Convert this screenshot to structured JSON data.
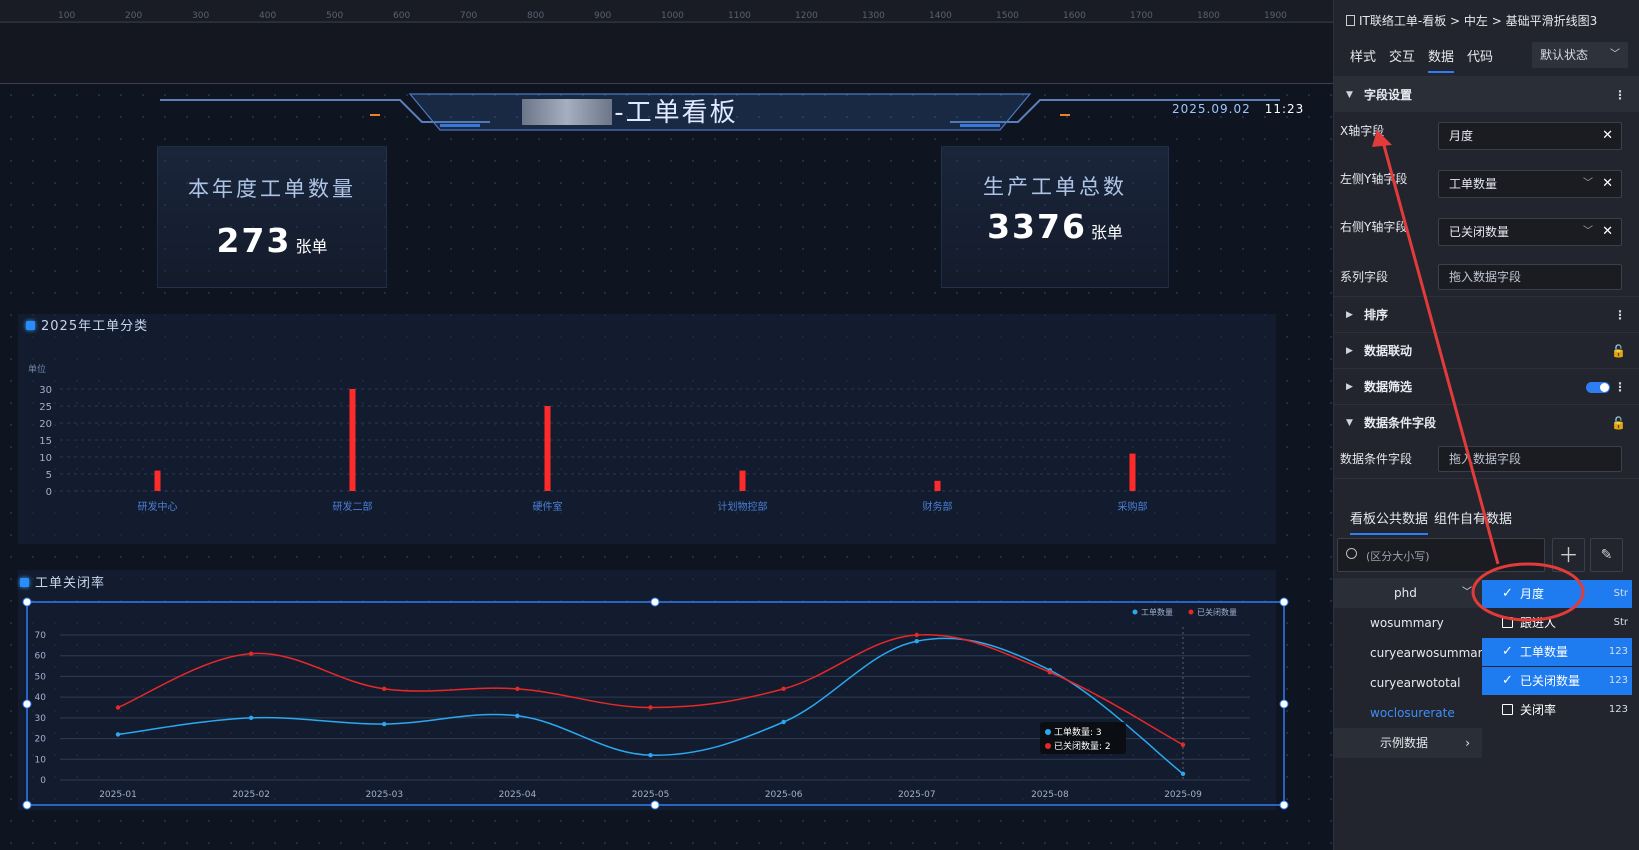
{
  "ruler": [
    "100",
    "200",
    "300",
    "400",
    "500",
    "600",
    "700",
    "800",
    "900",
    "1000",
    "1100",
    "1200",
    "1300",
    "1400",
    "1500",
    "1600",
    "1700",
    "1800",
    "1900"
  ],
  "header": {
    "title": "-工单看板",
    "date": "2025.09.02",
    "time": "11:23"
  },
  "kpis": [
    {
      "label": "本年度工单数量",
      "value": "273",
      "unit": "张单"
    },
    {
      "label": "生产工单总数",
      "value": "3376",
      "unit": "张单"
    }
  ],
  "bar_panel": {
    "title": "2025年工单分类",
    "unit_label": "单位"
  },
  "line_panel": {
    "title": "工单关闭率"
  },
  "chart_data": [
    {
      "type": "bar",
      "title": "2025年工单分类",
      "ylabel": "单位",
      "categories": [
        "研发中心",
        "研发二部",
        "硬件室",
        "计划物控部",
        "财务部",
        "采购部"
      ],
      "values": [
        6,
        30,
        25,
        6,
        3,
        11
      ],
      "ylim": [
        0,
        30
      ],
      "yticks": [
        "0",
        "5",
        "10",
        "15",
        "20",
        "25",
        "30"
      ],
      "bar_color": "#ff2b2b",
      "grid": true
    },
    {
      "type": "line",
      "title": "工单关闭率",
      "categories": [
        "2025-01",
        "2025-02",
        "2025-03",
        "2025-04",
        "2025-05",
        "2025-06",
        "2025-07",
        "2025-08",
        "2025-09"
      ],
      "series": [
        {
          "name": "工单数量",
          "color": "#2ba8f0",
          "values": [
            22,
            30,
            27,
            31,
            12,
            28,
            67,
            53,
            3
          ]
        },
        {
          "name": "已关闭数量",
          "color": "#e62828",
          "values": [
            35,
            61,
            44,
            44,
            35,
            44,
            70,
            52,
            17
          ]
        }
      ],
      "ylim": [
        0,
        70
      ],
      "yticks": [
        "0",
        "10",
        "20",
        "30",
        "40",
        "50",
        "60",
        "70"
      ],
      "legend": "top-right",
      "grid": true,
      "tooltip": {
        "lines": [
          "工单数量:  3",
          "已关闭数量:  2"
        ]
      }
    }
  ],
  "right_panel": {
    "breadcrumb": "IT联络工单-看板 > 中左 > 基础平滑折线图3",
    "tabs": [
      "样式",
      "交互",
      "数据",
      "代码"
    ],
    "state_select": "默认状态",
    "field_section": "字段设置",
    "x_label": "X轴字段",
    "x_value": "月度",
    "ly_label": "左侧Y轴字段",
    "ly_value": "工单数量",
    "ry_label": "右侧Y轴字段",
    "ry_value": "已关闭数量",
    "series_label": "系列字段",
    "series_placeholder": "拖入数据字段",
    "sections": [
      "排序",
      "数据联动",
      "数据筛选",
      "数据条件字段"
    ],
    "cond_label": "数据条件字段",
    "cond_placeholder": "拖入数据字段",
    "data_tabs": [
      "看板公共数据",
      "组件自有数据"
    ],
    "search_placeholder": "(区分大小写)",
    "packages": [
      "phd",
      "wosummary",
      "curyearwosummary",
      "curyearwototal",
      "woclosurerate",
      "示例数据"
    ],
    "fields": [
      {
        "name": "月度",
        "type": "Str",
        "selected": true
      },
      {
        "name": "跟进人",
        "type": "Str",
        "selected": false
      },
      {
        "name": "工单数量",
        "type": "123",
        "selected": true
      },
      {
        "name": "已关闭数量",
        "type": "123",
        "selected": true
      },
      {
        "name": "关闭率",
        "type": "123",
        "selected": false
      }
    ]
  }
}
